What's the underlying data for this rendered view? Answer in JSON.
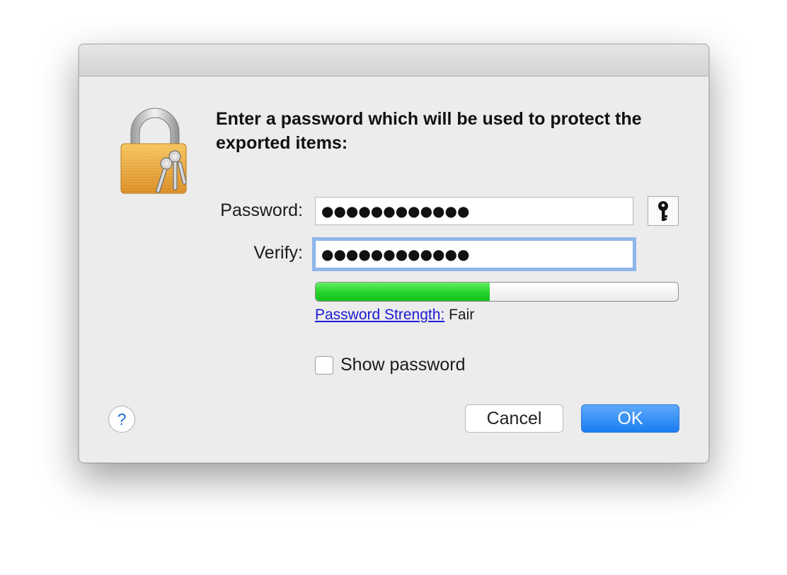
{
  "dialog": {
    "heading": "Enter a password which will be used to protect the exported items:",
    "password_label": "Password:",
    "password_value": "●●●●●●●●●●●●",
    "verify_label": "Verify:",
    "verify_value": "●●●●●●●●●●●●",
    "strength_link": "Password Strength:",
    "strength_value": "Fair",
    "strength_fraction": 0.48,
    "show_password_label": "Show password",
    "show_password_checked": false,
    "help_label": "?",
    "cancel_label": "Cancel",
    "ok_label": "OK"
  },
  "icons": {
    "lock": "lock-with-keys-icon",
    "key": "key-icon"
  },
  "colors": {
    "accent": "#1a7df0",
    "strength_fill": "#22d22a",
    "link": "#1a1ad4",
    "focus_ring": "#8fb7ea"
  }
}
